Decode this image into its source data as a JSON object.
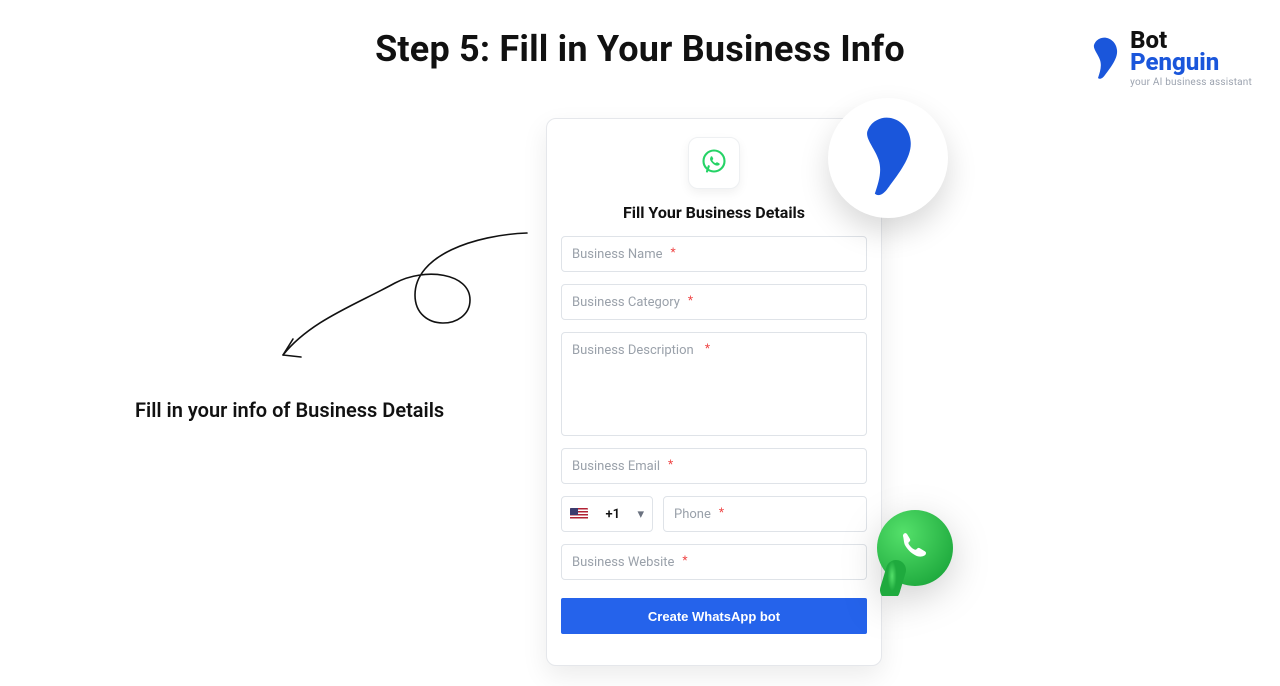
{
  "title": "Step 5: Fill in Your Business Info",
  "brand": {
    "line1": "Bot",
    "line2": "Penguin",
    "tagline": "your AI business assistant"
  },
  "annotation": "Fill in your info of Business Details",
  "card": {
    "heading": "Fill Your Business Details",
    "fields": {
      "name_ph": "Business Name",
      "category_ph": "Business Category",
      "description_ph": "Business Description",
      "email_ph": "Business Email",
      "dial_code": "+1",
      "phone_ph": "Phone",
      "website_ph": "Business Website"
    },
    "cta": "Create WhatsApp bot",
    "required_mark": "*"
  }
}
